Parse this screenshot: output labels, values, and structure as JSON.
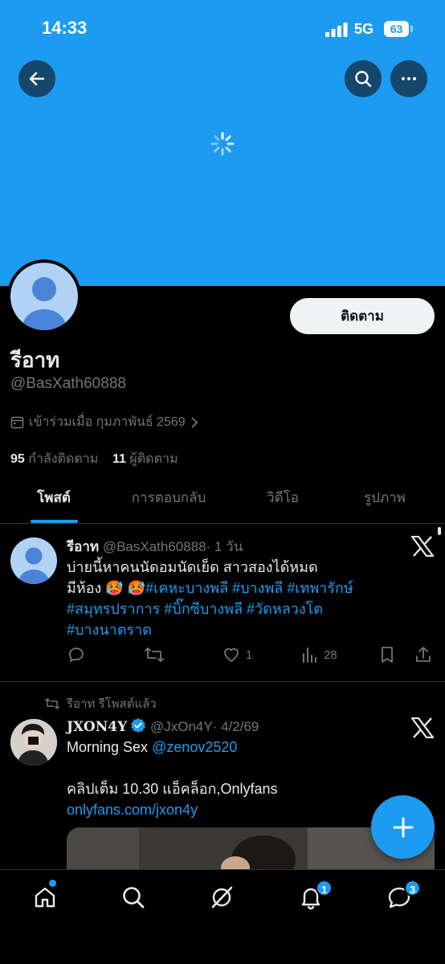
{
  "status_bar": {
    "time": "14:33",
    "network": "5G",
    "battery": "63"
  },
  "icons": {
    "back": "arrow-left-icon",
    "search": "search-icon",
    "more": "more-horizontal-icon",
    "loading": "loading-spinner-icon"
  },
  "profile": {
    "follow_label": "ติดตาม",
    "display_name": "รีอาท",
    "handle": "@BasXath60888",
    "joined": "เข้าร่วมเมื่อ กุมภาพันธ์ 2569",
    "following_count": "95",
    "following_label": "กำลังติดตาม",
    "followers_count": "11",
    "followers_label": "ผู้ติดตาม"
  },
  "tabs": [
    {
      "label": "โพสต์",
      "active": true
    },
    {
      "label": "การตอบกลับ",
      "active": false
    },
    {
      "label": "วิดีโอ",
      "active": false
    },
    {
      "label": "รูปภาพ",
      "active": false
    }
  ],
  "posts": [
    {
      "name": "รีอาท",
      "handle": "@BasXath60888",
      "time": "· 1 วัน",
      "line1": "บ่ายนี้หาคนนัดอมนัดเย็ด สาวสองได้หมด",
      "line2_text": "มีห้อง 🥵 🥵",
      "tags_line2": "#เคหะบางพลี #บางพลี #เทพารักษ์",
      "tags_line3": "#สมุทรปราการ #บิ๊กซีบางพลี #วัดหลวงโต",
      "tags_line4": "#บางนาตราด",
      "likes": "1",
      "views": "28"
    },
    {
      "repost_label": "รีอาท รีโพสต์แล้ว",
      "name": "JXON4Y",
      "handle": "@JxOn4Y",
      "time": "· 4/2/69",
      "line1_text": "Morning Sex",
      "line1_mention": "@zenov2520",
      "line2": "คลิปเต็ม 10.30 แอ็คล็อก,Onlyfans",
      "link": "onlyfans.com/jxon4y"
    }
  ],
  "bottom_nav": {
    "notifications_badge": "1",
    "messages_badge": "3"
  },
  "colors": {
    "accent": "#1d9bf0",
    "background": "#000000",
    "muted": "#71767b"
  }
}
